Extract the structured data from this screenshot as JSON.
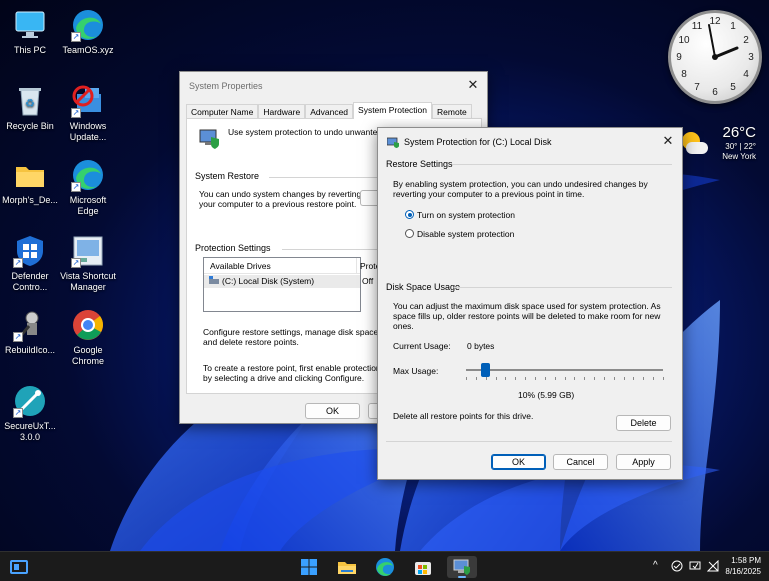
{
  "desktop": {
    "icons": [
      {
        "label": "This PC",
        "icon": "monitor-icon"
      },
      {
        "label": "TeamOS.xyz",
        "icon": "edge-icon"
      },
      {
        "label": "Recycle Bin",
        "icon": "recycle-bin-icon"
      },
      {
        "label": "Windows Update...",
        "icon": "windows-update-icon"
      },
      {
        "label": "Morph's_De...",
        "icon": "folder-icon"
      },
      {
        "label": "Microsoft Edge",
        "icon": "edge-icon"
      },
      {
        "label": "Defender Contro...",
        "icon": "defender-shield-icon"
      },
      {
        "label": "Vista Shortcut Manager",
        "icon": "vista-shortcut-icon"
      },
      {
        "label": "RebuildIco...",
        "icon": "rebuild-icon"
      },
      {
        "label": "Google Chrome",
        "icon": "chrome-icon"
      },
      {
        "label": "SecureUxT... 3.0.0",
        "icon": "secureux-icon"
      }
    ]
  },
  "clock_widget": {
    "numbers": [
      "12",
      "1",
      "2",
      "3",
      "4",
      "5",
      "6",
      "7",
      "8",
      "9",
      "10",
      "11"
    ],
    "time_shown": "1:58"
  },
  "weather_widget": {
    "temp": "26°C",
    "range": "30° | 22°",
    "city": "New York",
    "icon": "partly-cloudy-icon"
  },
  "system_properties": {
    "title": "System Properties",
    "tabs": [
      "Computer Name",
      "Hardware",
      "Advanced",
      "System Protection",
      "Remote"
    ],
    "active_tab": "System Protection",
    "intro": "Use system protection to undo unwanted s",
    "system_restore": {
      "title": "System Restore",
      "text_line1": "You can undo system changes by reverting",
      "text_line2": "your computer to a previous restore point."
    },
    "protection_settings": {
      "title": "Protection Settings",
      "col_drives": "Available Drives",
      "col_protection": "Prote",
      "rows": [
        {
          "drive": "(C:) Local Disk (System)",
          "protection": "Off"
        }
      ],
      "configure_line1": "Configure restore settings, manage disk space,",
      "configure_line2": "and delete restore points.",
      "create_line1": "To create a restore point, first enable protection",
      "create_line2": "by selecting a drive and clicking Configure."
    },
    "ok_label": "OK"
  },
  "protection_dialog": {
    "title": "System Protection for (C:) Local Disk",
    "restore_settings": {
      "title": "Restore Settings",
      "desc_line1": "By enabling system protection, you can undo undesired changes by",
      "desc_line2": "reverting your computer to a previous point in time.",
      "option_on": "Turn on system protection",
      "option_off": "Disable system protection",
      "selected": "on"
    },
    "disk_space": {
      "title": "Disk Space Usage",
      "desc_line1": "You can adjust the maximum disk space used for system protection. As",
      "desc_line2": "space fills up, older restore points will be deleted to make room for new",
      "desc_line3": "ones.",
      "current_label": "Current Usage:",
      "current_value": "0 bytes",
      "max_label": "Max Usage:",
      "max_fraction": 0.1,
      "max_value": "10% (5.99 GB)",
      "delete_text": "Delete all restore points for this drive.",
      "delete_label": "Delete"
    },
    "ok_label": "OK",
    "cancel_label": "Cancel",
    "apply_label": "Apply"
  },
  "taskbar": {
    "time": "1:58 PM",
    "date": "8/16/2025",
    "pinned": [
      "start-icon",
      "widgets-icon",
      "file-explorer-icon",
      "edge-icon",
      "store-icon",
      "system-properties-icon"
    ]
  }
}
